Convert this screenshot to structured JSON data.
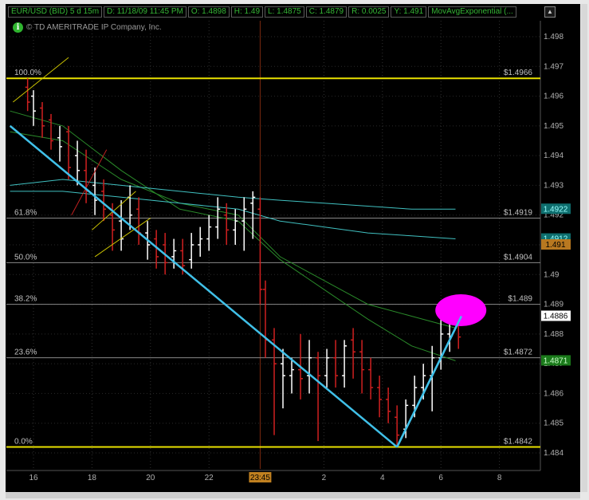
{
  "header": {
    "symbol": "EUR/USD (BID) 5 d 15m",
    "datetime": "D: 11/18/09 11:45 PM",
    "open": "O: 1.4898",
    "high": "H: 1.49",
    "low": "L: 1.4875",
    "close": "C: 1.4879",
    "range": "R: 0.0025",
    "y": "Y: 1.491",
    "study": "MovAvgExponential (..."
  },
  "copyright": "© TD AMERITRADE IP Company, Inc.",
  "up_button": "▲",
  "chart_data": {
    "type": "line",
    "ylim": [
      1.4836,
      1.4987
    ],
    "y_ticks": [
      "1.498",
      "1.497",
      "1.496",
      "1.495",
      "1.494",
      "1.493",
      "1.492",
      "1.491",
      "1.49",
      "1.489",
      "1.488",
      "1.487",
      "1.486",
      "1.485",
      "1.484"
    ],
    "x_ticks": [
      "16",
      "18",
      "20",
      "22",
      "23:45",
      "2",
      "4",
      "6",
      "8"
    ],
    "fib_levels": [
      {
        "label": "100.0%",
        "value": 1.4966,
        "price_label": "$1.4966",
        "color": "#e8e000"
      },
      {
        "label": "61.8%",
        "value": 1.4919,
        "price_label": "$1.4919",
        "color": "#888888"
      },
      {
        "label": "50.0%",
        "value": 1.4904,
        "price_label": "$1.4904",
        "color": "#888888"
      },
      {
        "label": "38.2%",
        "value": 1.489,
        "price_label": "$1.489",
        "color": "#888888"
      },
      {
        "label": "23.6%",
        "value": 1.4872,
        "price_label": "$1.4872",
        "color": "#888888"
      },
      {
        "label": "0.0%",
        "value": 1.4842,
        "price_label": "$1.4842",
        "color": "#e8e000"
      }
    ],
    "price_badges": [
      {
        "text": "1.4922",
        "value": 1.4922,
        "bg": "#0e6e6e",
        "fg": "#9ff"
      },
      {
        "text": "1.4912",
        "value": 1.4912,
        "bg": "#0e6e6e",
        "fg": "#9ff"
      },
      {
        "text": "1.491",
        "value": 1.491,
        "bg": "#b87820",
        "fg": "#000"
      },
      {
        "text": "1.4886",
        "value": 1.4886,
        "bg": "#ffffff",
        "fg": "#000"
      },
      {
        "text": "1.4871",
        "value": 1.4871,
        "bg": "#1a7a1a",
        "fg": "#cfc"
      }
    ],
    "candles": [
      [
        15.8,
        1.4963,
        1.4958,
        1.4966,
        1.4955,
        "r"
      ],
      [
        16.0,
        1.496,
        1.4955,
        1.4962,
        1.495,
        "w"
      ],
      [
        16.3,
        1.4956,
        1.495,
        1.4958,
        1.4946,
        "r"
      ],
      [
        16.6,
        1.4952,
        1.4945,
        1.4954,
        1.4942,
        "r"
      ],
      [
        16.9,
        1.4946,
        1.4943,
        1.495,
        1.4938,
        "w"
      ],
      [
        17.2,
        1.4948,
        1.4936,
        1.495,
        1.4932,
        "r"
      ],
      [
        17.5,
        1.494,
        1.4935,
        1.4945,
        1.493,
        "w"
      ],
      [
        17.8,
        1.4935,
        1.4928,
        1.4942,
        1.4924,
        "r"
      ],
      [
        18.1,
        1.493,
        1.4925,
        1.4936,
        1.492,
        "w"
      ],
      [
        18.4,
        1.4928,
        1.4922,
        1.4932,
        1.4918,
        "r"
      ],
      [
        18.7,
        1.492,
        1.4915,
        1.4924,
        1.4908,
        "r"
      ],
      [
        19.0,
        1.4918,
        1.4912,
        1.4925,
        1.4908,
        "w"
      ],
      [
        19.3,
        1.4926,
        1.492,
        1.493,
        1.4915,
        "w"
      ],
      [
        19.6,
        1.4922,
        1.4914,
        1.4926,
        1.491,
        "r"
      ],
      [
        19.9,
        1.4914,
        1.491,
        1.4918,
        1.4905,
        "w"
      ],
      [
        20.2,
        1.4912,
        1.4906,
        1.4915,
        1.4902,
        "r"
      ],
      [
        20.5,
        1.491,
        1.4904,
        1.4914,
        1.49,
        "r"
      ],
      [
        20.8,
        1.4906,
        1.4908,
        1.4912,
        1.4902,
        "w"
      ],
      [
        21.1,
        1.4908,
        1.4903,
        1.4912,
        1.49,
        "r"
      ],
      [
        21.4,
        1.4905,
        1.491,
        1.4914,
        1.4902,
        "w"
      ],
      [
        21.7,
        1.491,
        1.4912,
        1.4916,
        1.4906,
        "w"
      ],
      [
        22.0,
        1.4912,
        1.4916,
        1.492,
        1.4908,
        "w"
      ],
      [
        22.3,
        1.4916,
        1.4922,
        1.4926,
        1.4912,
        "w"
      ],
      [
        22.6,
        1.492,
        1.4915,
        1.4924,
        1.491,
        "r"
      ],
      [
        22.9,
        1.4915,
        1.4918,
        1.4922,
        1.491,
        "w"
      ],
      [
        23.2,
        1.4918,
        1.4922,
        1.4926,
        1.4908,
        "w"
      ],
      [
        23.5,
        1.4924,
        1.4926,
        1.4928,
        1.4912,
        "w"
      ],
      [
        23.75,
        1.4922,
        1.4895,
        1.4926,
        1.489,
        "r"
      ],
      [
        0.0,
        1.4895,
        1.4878,
        1.4898,
        1.4872,
        "r"
      ],
      [
        0.3,
        1.4878,
        1.487,
        1.4882,
        1.4846,
        "r"
      ],
      [
        0.6,
        1.487,
        1.4866,
        1.4875,
        1.4855,
        "w"
      ],
      [
        0.9,
        1.4866,
        1.4868,
        1.4872,
        1.486,
        "w"
      ],
      [
        1.2,
        1.4868,
        1.4865,
        1.488,
        1.4858,
        "r"
      ],
      [
        1.5,
        1.4866,
        1.4872,
        1.4878,
        1.486,
        "w"
      ],
      [
        1.8,
        1.4872,
        1.4866,
        1.4874,
        1.4844,
        "r"
      ],
      [
        2.1,
        1.4866,
        1.4872,
        1.4875,
        1.4862,
        "w"
      ],
      [
        2.4,
        1.4872,
        1.4866,
        1.4878,
        1.4862,
        "r"
      ],
      [
        2.7,
        1.4866,
        1.4876,
        1.4878,
        1.4862,
        "w"
      ],
      [
        3.0,
        1.4878,
        1.4874,
        1.4882,
        1.4865,
        "r"
      ],
      [
        3.3,
        1.4874,
        1.4868,
        1.4878,
        1.486,
        "r"
      ],
      [
        3.6,
        1.4868,
        1.4862,
        1.4872,
        1.4858,
        "r"
      ],
      [
        3.9,
        1.4862,
        1.4858,
        1.4866,
        1.4852,
        "r"
      ],
      [
        4.2,
        1.4858,
        1.4854,
        1.4862,
        1.485,
        "r"
      ],
      [
        4.5,
        1.4852,
        1.4846,
        1.4856,
        1.4842,
        "r"
      ],
      [
        4.8,
        1.4848,
        1.4856,
        1.4858,
        1.4845,
        "w"
      ],
      [
        5.1,
        1.4856,
        1.4862,
        1.4866,
        1.4852,
        "w"
      ],
      [
        5.4,
        1.4862,
        1.4866,
        1.487,
        1.4858,
        "w"
      ],
      [
        5.7,
        1.4866,
        1.4872,
        1.4876,
        1.4854,
        "w"
      ],
      [
        6.0,
        1.4872,
        1.488,
        1.4885,
        1.4868,
        "w"
      ],
      [
        6.3,
        1.488,
        1.4888,
        1.4892,
        1.4874,
        "w"
      ],
      [
        6.6,
        1.4888,
        1.4879,
        1.4892,
        1.4875,
        "r"
      ]
    ],
    "ema_series": [
      {
        "color": "#2a8a2a",
        "points": [
          [
            15.2,
            1.4955
          ],
          [
            17,
            1.495
          ],
          [
            19,
            1.4935
          ],
          [
            21,
            1.4922
          ],
          [
            23,
            1.4918
          ],
          [
            0.5,
            1.4905
          ],
          [
            2,
            1.4895
          ],
          [
            3.5,
            1.4885
          ],
          [
            5,
            1.4876
          ],
          [
            6.5,
            1.4871
          ]
        ]
      },
      {
        "color": "#2a8a2a",
        "points": [
          [
            15.2,
            1.4948
          ],
          [
            17,
            1.4945
          ],
          [
            19,
            1.4932
          ],
          [
            21,
            1.4924
          ],
          [
            23,
            1.492
          ],
          [
            0.5,
            1.4906
          ],
          [
            2,
            1.4898
          ],
          [
            3.5,
            1.489
          ],
          [
            5,
            1.4886
          ],
          [
            6.5,
            1.4882
          ]
        ]
      },
      {
        "color": "#40c0c0",
        "points": [
          [
            15.2,
            1.493
          ],
          [
            17,
            1.4932
          ],
          [
            19,
            1.493
          ],
          [
            21,
            1.4928
          ],
          [
            23,
            1.4926
          ],
          [
            0.5,
            1.4925
          ],
          [
            2,
            1.4924
          ],
          [
            3.5,
            1.4923
          ],
          [
            5,
            1.4922
          ],
          [
            6.5,
            1.4922
          ]
        ]
      },
      {
        "color": "#40c0c0",
        "points": [
          [
            15.2,
            1.4928
          ],
          [
            17,
            1.4928
          ],
          [
            19,
            1.4926
          ],
          [
            21,
            1.4924
          ],
          [
            23,
            1.4922
          ],
          [
            0.5,
            1.4918
          ],
          [
            2,
            1.4916
          ],
          [
            3.5,
            1.4914
          ],
          [
            5,
            1.4913
          ],
          [
            6.5,
            1.4912
          ]
        ]
      }
    ],
    "trend_lines": [
      {
        "color": "#40c0e8",
        "from": [
          15.2,
          1.495
        ],
        "to": [
          4.5,
          1.4842
        ]
      },
      {
        "color": "#40c0e8",
        "from": [
          4.5,
          1.4842
        ],
        "to": [
          6.7,
          1.4886
        ]
      }
    ],
    "channel_lines": [
      {
        "color": "#c8c000",
        "from": [
          15.3,
          1.4958
        ],
        "to": [
          17.2,
          1.4973
        ]
      },
      {
        "color": "#c8c000",
        "from": [
          18.0,
          1.4915
        ],
        "to": [
          19.5,
          1.4928
        ]
      },
      {
        "color": "#c8c000",
        "from": [
          18.1,
          1.4906
        ],
        "to": [
          20.0,
          1.4919
        ]
      },
      {
        "color": "#c02020",
        "from": [
          17.3,
          1.492
        ],
        "to": [
          18.5,
          1.4942
        ]
      }
    ],
    "highlight_circle": {
      "x": 6.3,
      "y": 1.4888,
      "color": "#ff00ff"
    }
  }
}
